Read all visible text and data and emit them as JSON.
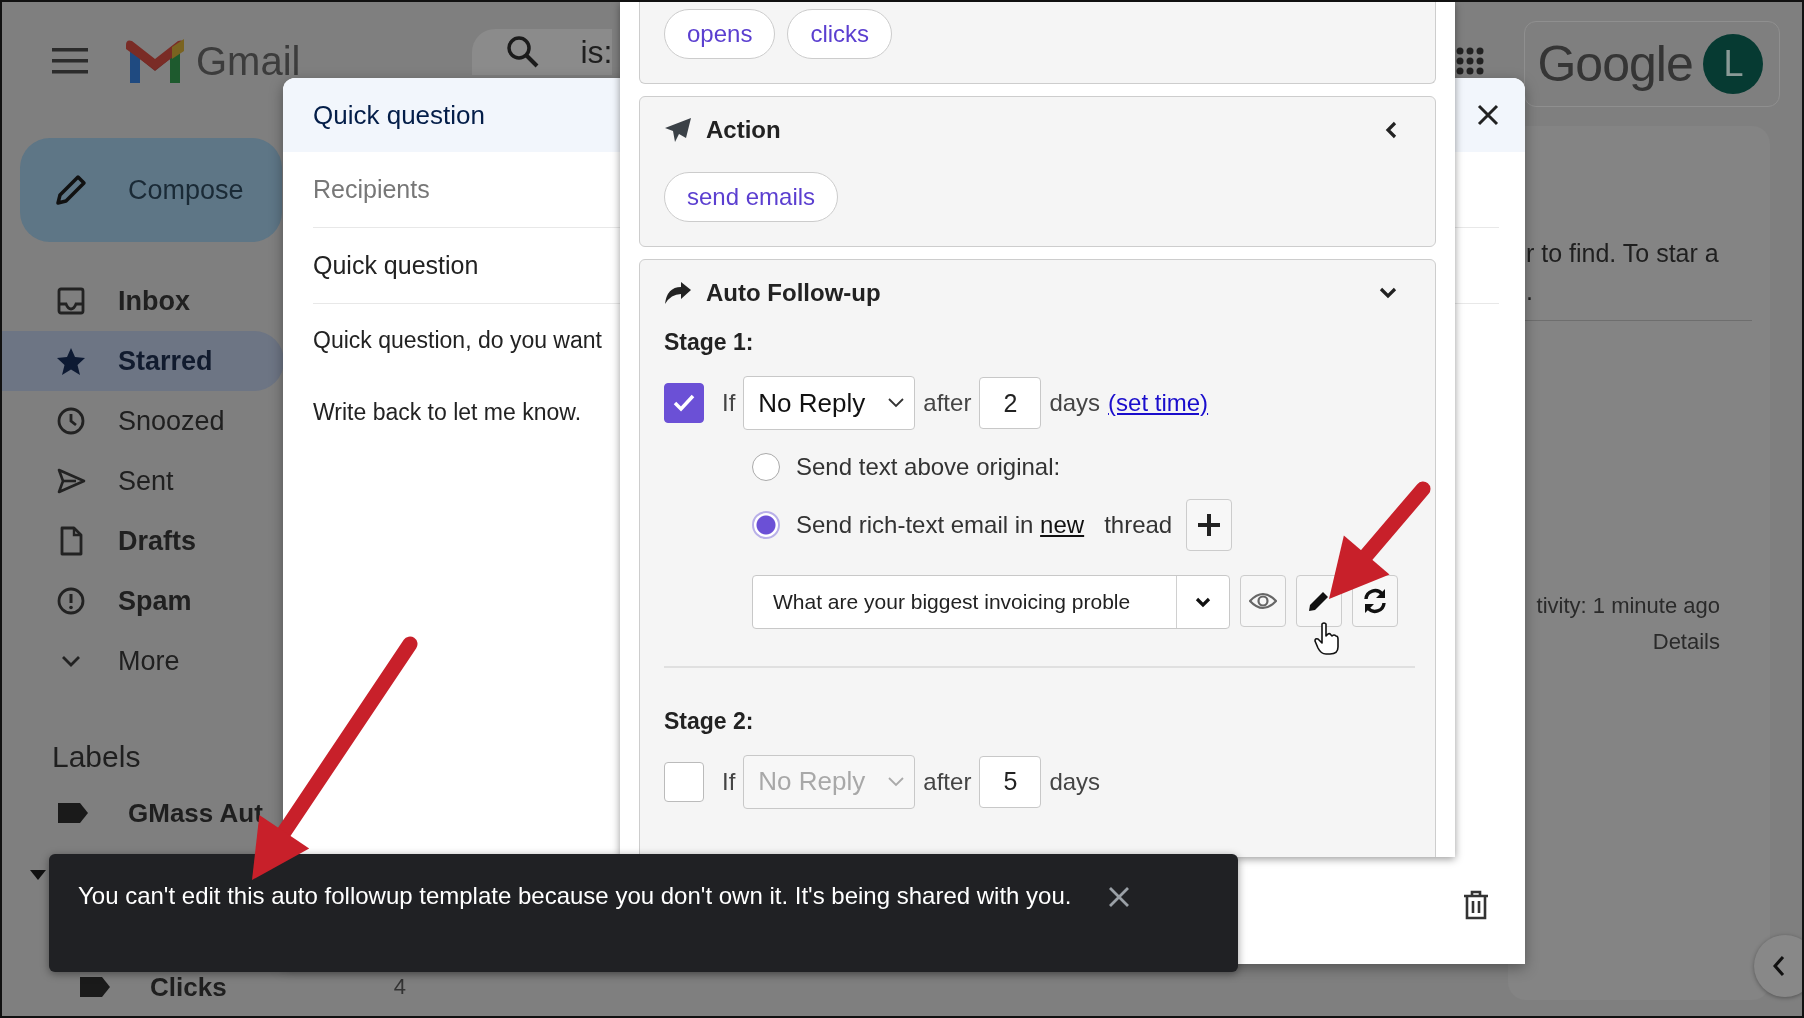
{
  "gmail": {
    "header": {
      "product_name": "Gmail",
      "search_query": "is:",
      "account_wordmark": "Google",
      "avatar_letter": "L"
    },
    "compose_button": "Compose",
    "nav": [
      {
        "label": "Inbox",
        "unread": true,
        "selected": false
      },
      {
        "label": "Starred",
        "unread": true,
        "selected": true
      },
      {
        "label": "Snoozed",
        "unread": false,
        "selected": false
      },
      {
        "label": "Sent",
        "unread": false,
        "selected": false
      },
      {
        "label": "Drafts",
        "unread": true,
        "selected": false
      },
      {
        "label": "Spam",
        "unread": true,
        "selected": false
      },
      {
        "label": "More",
        "unread": false,
        "selected": false
      }
    ],
    "labels_heading": "Labels",
    "labels": [
      {
        "name": "GMass Aut"
      },
      {
        "name": "Clicks",
        "count": "4"
      }
    ],
    "content": {
      "message_lines": [
        "r to find. To star a",
        "."
      ],
      "activity": "tivity: 1 minute ago",
      "details_link": "Details"
    }
  },
  "compose_window": {
    "title": "Quick question",
    "recipients_placeholder": "Recipients",
    "subject": "Quick question",
    "body": [
      "Quick question, do you want",
      "Write back to let me know."
    ]
  },
  "gmass_panel": {
    "trigger_chips": [
      {
        "label": "opens"
      },
      {
        "label": "clicks"
      }
    ],
    "action": {
      "title": "Action",
      "expanded": false,
      "chips": [
        {
          "label": "send emails"
        }
      ]
    },
    "auto_followup": {
      "title": "Auto Follow-up",
      "expanded": true,
      "stages": [
        {
          "label": "Stage 1:",
          "checked": true,
          "if_label": "If",
          "condition": "No Reply",
          "after_label": "after",
          "days": "2",
          "days_label": "days",
          "set_time_link": "(set time)",
          "options": [
            {
              "selected": false,
              "text": "Send text above original:",
              "add_button": false
            },
            {
              "selected": true,
              "text": "Send rich-text email in",
              "link": "new",
              "text_after": "thread",
              "add_button": true
            }
          ],
          "template": "What are your biggest invoicing proble"
        },
        {
          "label": "Stage 2:",
          "checked": false,
          "if_label": "If",
          "condition": "No Reply",
          "after_label": "after",
          "days": "5",
          "days_label": "days"
        }
      ]
    }
  },
  "toast": {
    "message": "You can't edit this auto followup template because you don't own it. It's being shared with you."
  }
}
